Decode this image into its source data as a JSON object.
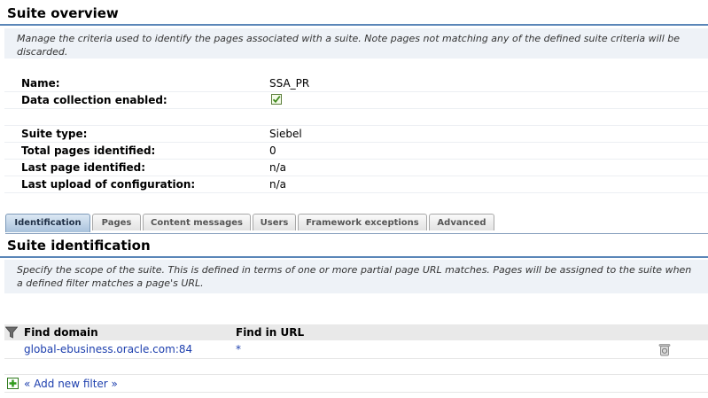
{
  "overview": {
    "title": "Suite overview",
    "description": "Manage the criteria used to identify the pages associated with a suite. Note pages not matching any of the defined suite criteria will be discarded.",
    "fields": [
      {
        "label": "Name:",
        "value": "SSA_PR"
      },
      {
        "label": "Data collection enabled:",
        "checked": true
      },
      {
        "label": "Suite type:",
        "value": "Siebel"
      },
      {
        "label": "Total pages identified:",
        "value": "0"
      },
      {
        "label": "Last page identified:",
        "value": "n/a"
      },
      {
        "label": "Last upload of configuration:",
        "value": "n/a"
      }
    ]
  },
  "tabs": [
    "Identification",
    "Pages",
    "Content messages",
    "Users",
    "Framework exceptions",
    "Advanced"
  ],
  "active_tab": "Identification",
  "identification": {
    "title": "Suite identification",
    "description": "Specify the scope of the suite. This is defined in terms of one or more partial page URL matches. Pages will be assigned to the suite when a defined filter matches a page's URL.",
    "columns": {
      "find_domain": "Find domain",
      "find_in_url": "Find in URL"
    },
    "filters": [
      {
        "find_domain": "global-ebusiness.oracle.com:84",
        "find_in_url": "*"
      }
    ],
    "add_filter_label": "« Add new filter »"
  },
  "colors": {
    "header_rule": "#5a86b8",
    "desc_bg": "#eef2f7",
    "link": "#1d3fae",
    "table_head_bg": "#e9e9e9"
  }
}
